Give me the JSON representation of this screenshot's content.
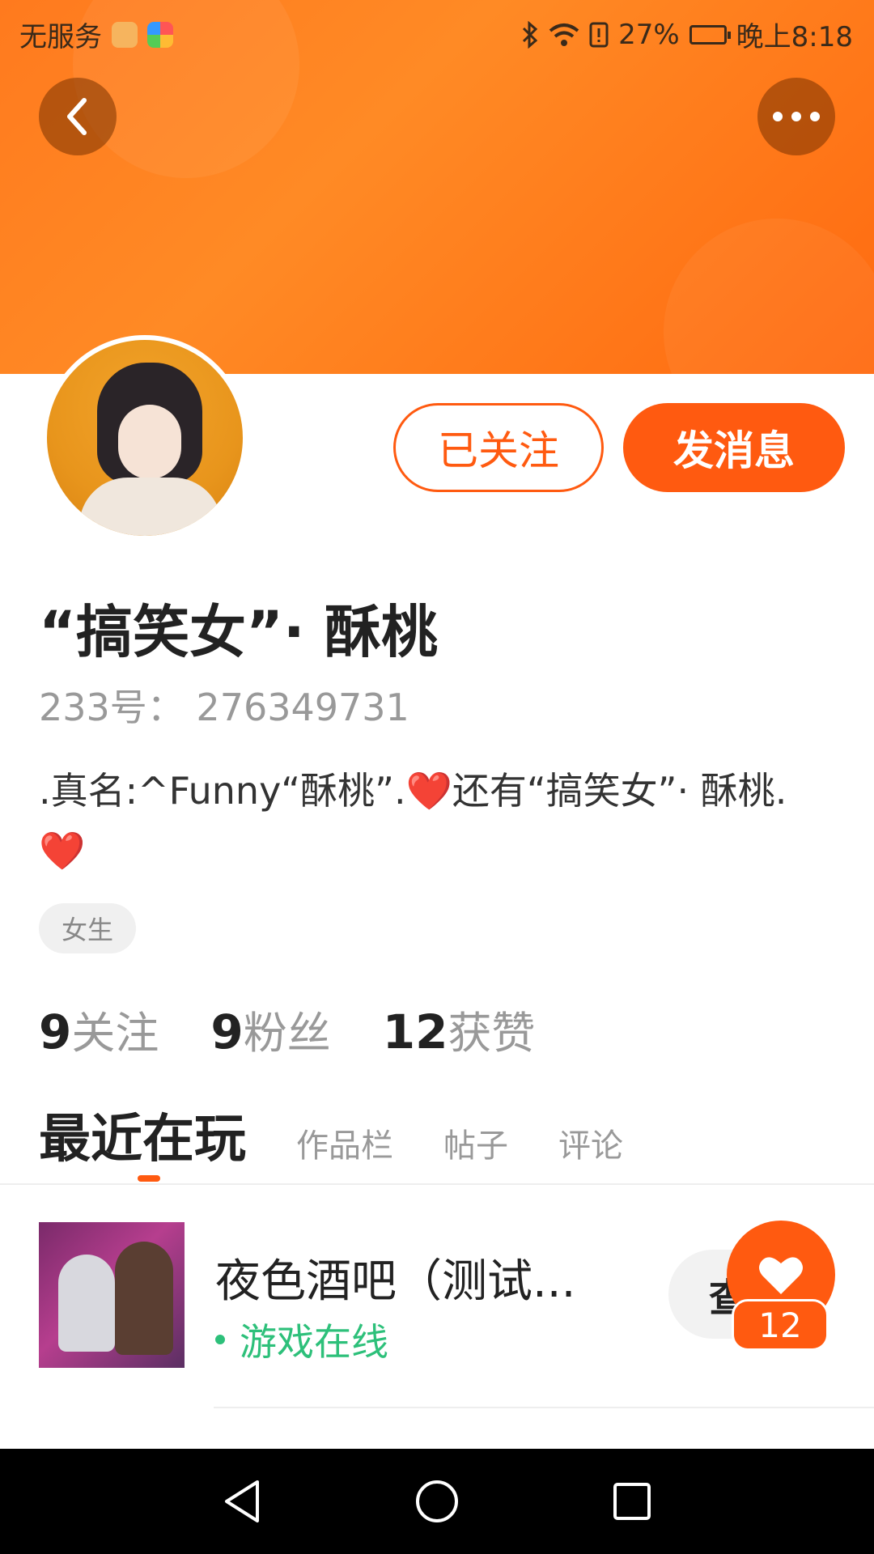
{
  "status_bar": {
    "carrier": "无服务",
    "battery_percent": "27%",
    "time": "晚上8:18"
  },
  "icons": {
    "back": "chevron-left-icon",
    "more": "more-dots-icon",
    "bluetooth": "bluetooth-icon",
    "wifi": "wifi-icon",
    "like": "heart-icon"
  },
  "profile": {
    "follow_label": "已关注",
    "message_label": "发消息",
    "username": "“搞笑女”· 酥桃",
    "id_text": "233号： 276349731",
    "bio": ".真名:^Funny“酥桃”.❤️还有“搞笑女”· 酥桃.❤️",
    "tag": "女生"
  },
  "stats": [
    {
      "value": "9",
      "label": "关注"
    },
    {
      "value": "9",
      "label": "粉丝"
    },
    {
      "value": "12",
      "label": "获赞"
    }
  ],
  "tabs": {
    "active": "最近在玩",
    "items": [
      "作品栏",
      "帖子",
      "评论"
    ]
  },
  "recent_game": {
    "title": "夜色酒吧（测试...",
    "status": "游戏在线",
    "view_label": "查"
  },
  "like_badge": {
    "count": "12"
  },
  "colors": {
    "accent": "#ff5a10",
    "banner": "#ff7a1e",
    "online": "#2dc07a"
  }
}
